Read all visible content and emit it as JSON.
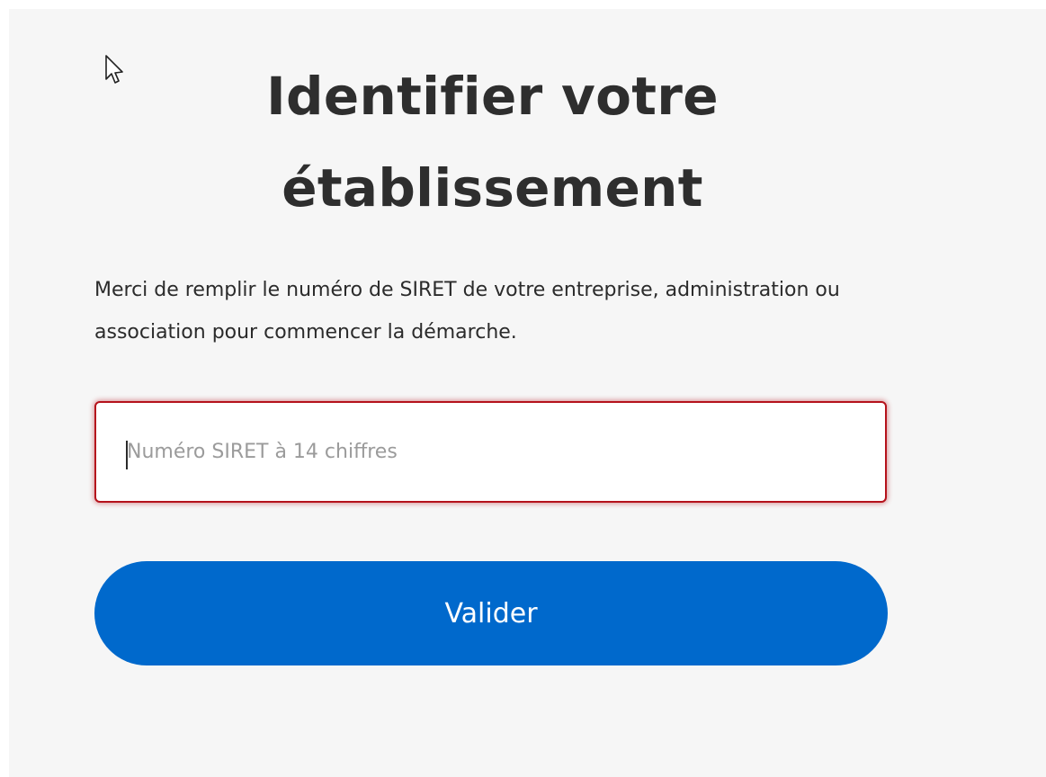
{
  "form": {
    "title": "Identifier votre établissement",
    "description": "Merci de remplir le numéro de SIRET de votre entreprise, administration ou association pour commencer la démarche.",
    "siret_input": {
      "value": "",
      "placeholder": "Numéro SIRET à 14 chiffres",
      "state": "invalid"
    },
    "submit_label": "Valider"
  },
  "icons": {
    "cursor": "mouse-pointer-icon"
  },
  "colors": {
    "page_background": "#f6f6f6",
    "title_text": "#2e2e2e",
    "input_error_border": "#b5121b",
    "button_background": "#0069cc",
    "button_text": "#ffffff"
  }
}
